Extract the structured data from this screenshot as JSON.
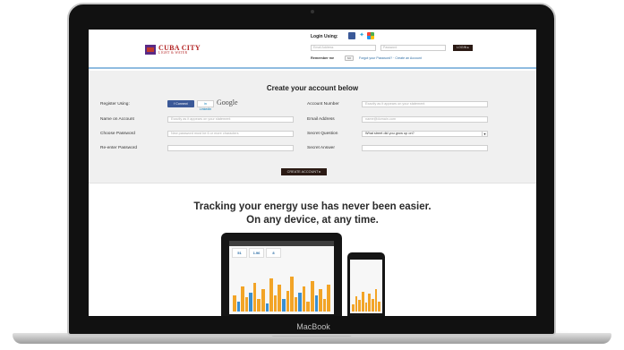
{
  "device": {
    "label": "MacBook"
  },
  "header": {
    "logo_main": "CUBA CITY",
    "logo_sub": "LIGHT & WATER",
    "login_label": "Login Using:",
    "email_placeholder": "Email Address",
    "password_placeholder": "Password",
    "login_button": "LOGIN ▸",
    "remember_label": "Remember me",
    "remember_toggle": "NO",
    "forgot_links": "Forgot your Password? · Create an Account"
  },
  "create_account": {
    "title": "Create your account below",
    "register_label": "Register Using:",
    "facebook_label": "f  Connect",
    "linkedin_label": "in Linkedin",
    "google_label": "Google",
    "name_label": "Name on Account",
    "name_placeholder": "Exactly as it appears on your statement",
    "choose_password_label": "Choose Password",
    "choose_password_placeholder": "New password must be 6 or more characters",
    "reenter_password_label": "Re-enter Password",
    "account_number_label": "Account Number",
    "account_number_placeholder": "Exactly as it appears on your statement",
    "email_label": "Email Address",
    "email_placeholder": "name@domain.com",
    "secret_question_label": "Secret Question",
    "secret_question_value": "What street did you grow up on?",
    "secret_answer_label": "Secret Answer",
    "create_button": "CREATE ACCOUNT ▸"
  },
  "promo": {
    "headline_1": "Tracking your energy use has never been easier.",
    "headline_2": "On any device, at any time.",
    "card_1": "51",
    "card_2": "1.96",
    "card_3": "8"
  },
  "colors": {
    "brand": "#b22222",
    "accent_bar": "#f2a427",
    "accent_blue": "#3a8fd1"
  }
}
